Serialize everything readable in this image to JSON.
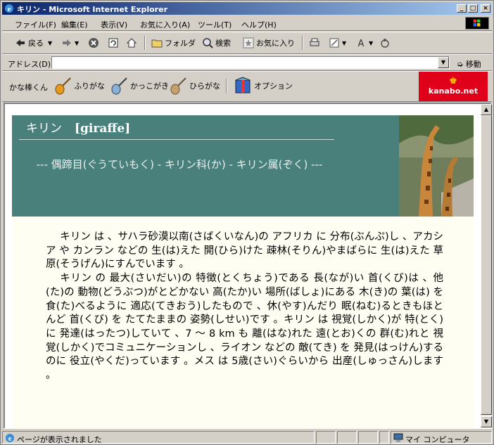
{
  "window": {
    "title": "キリン - Microsoft Internet Explorer",
    "minimize": "_",
    "maximize": "□",
    "close": "×"
  },
  "menu": [
    "ファイル(F)",
    "編集(E)",
    "表示(V)",
    "お気に入り(A)",
    "ツール(T)",
    "ヘルプ(H)"
  ],
  "toolbar": {
    "back": "戻る",
    "folder": "フォルダ",
    "search": "検索",
    "favorites": "お気に入り"
  },
  "address": {
    "label": "アドレス(D)",
    "value": "",
    "go": "移動"
  },
  "kanabar": {
    "brand": "かな棒くん",
    "furigana": "ふりがな",
    "kakkogaki": "かっこがき",
    "hiragana": "ひらがな",
    "option": "オプション",
    "logo": "kanabo.net"
  },
  "page": {
    "title_ja": "キリン",
    "title_en": "[giraffe]",
    "subtitle": "--- 偶蹄目(ぐうていもく) - キリン科(か) - キリン属(ぞく) ---",
    "paragraphs": [
      "キリン は 、サハラ砂漠以南(さばくいなん)の アフリカ に 分布(ぶんぷ)し 、アカシア や カンラン などの 生(は)えた 開(ひら)けた 疎林(そりん)やまばらに 生(は)えた 草原(そうげん)にすんでいます 。",
      "キリン の 最大(さいだい)の 特徴(とくちょう)である 長(なが)い 首(くび)は 、他(た)の 動物(どうぶつ)がとどかない 高(たか)い 場所(ばしょ)にある 木(き)の 葉(は) を 食(た)べるように 適応(てきおう)したもので 、休(やす)んだり 眠(ねむ)るときもほとんど 首(くび) を たてたままの 姿勢(しせい)です 。キリン は 視覚(しかく)が 特(とく)に 発達(はったつ)していて 、7 ～ 8 km も 離(はな)れた 遠(とお)くの 群(む)れと 視覚(しかく)でコミュニケーションし 、ライオン などの 敵(てき) を 発見(はっけん)するのに 役立(やくだ)っています 。メス は 5歳(さい)ぐらいから 出産(しゅっさん)します 。"
    ]
  },
  "status": {
    "text": "ページが表示されました",
    "zone": "マイ コンピュータ"
  }
}
